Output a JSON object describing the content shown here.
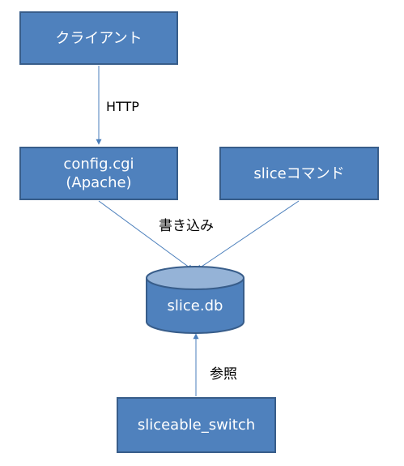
{
  "nodes": {
    "client": "クライアント",
    "config": "config.cgi\n(Apache)",
    "slice_command": "sliceコマンド",
    "database": "slice.db",
    "sliceable_switch": "sliceable_switch"
  },
  "edge_labels": {
    "http": "HTTP",
    "write": "書き込み",
    "reference": "参照"
  },
  "colors": {
    "box_fill": "#4f81bd",
    "box_border": "#385d8a",
    "db_top": "#95b3d7",
    "edge": "#4a7ebb",
    "text_light": "#ffffff",
    "text_dark": "#000000"
  }
}
